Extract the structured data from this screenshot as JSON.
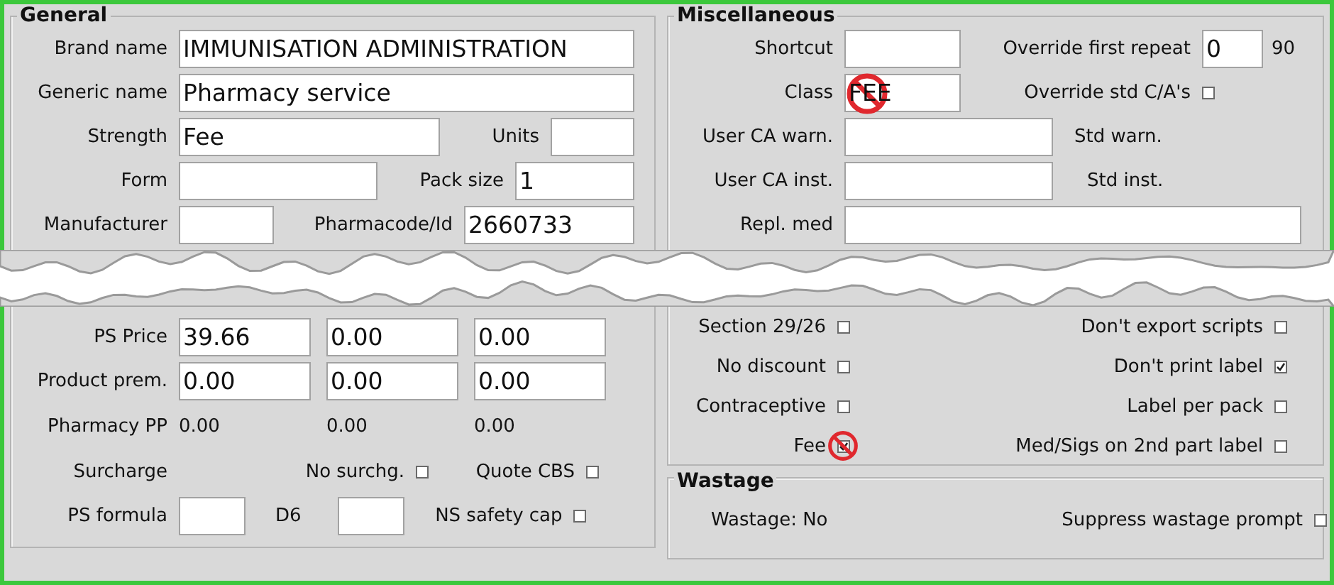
{
  "general": {
    "title": "General",
    "brand_name": {
      "label": "Brand name",
      "value": "IMMUNISATION ADMINISTRATION"
    },
    "generic_name": {
      "label": "Generic name",
      "value": "Pharmacy service"
    },
    "strength": {
      "label": "Strength",
      "value": "Fee"
    },
    "units": {
      "label": "Units"
    },
    "form": {
      "label": "Form"
    },
    "pack_size": {
      "label": "Pack size",
      "value": "1"
    },
    "manufacturer": {
      "label": "Manufacturer"
    },
    "pharmacode": {
      "label": "Pharmacode/Id",
      "value": "2660733"
    }
  },
  "pricing": {
    "ps_price": {
      "label": "PS Price",
      "values": [
        "39.66",
        "0.00",
        "0.00"
      ]
    },
    "product_prem": {
      "label": "Product prem.",
      "values": [
        "0.00",
        "0.00",
        "0.00"
      ]
    },
    "pharmacy_pp": {
      "label": "Pharmacy PP",
      "values": [
        "0.00",
        "0.00",
        "0.00"
      ]
    },
    "surcharge": {
      "label": "Surcharge"
    },
    "no_surcharge": {
      "label": "No surchg.",
      "checked": false
    },
    "quote_cbs": {
      "label": "Quote CBS",
      "checked": false
    },
    "ps_formula": {
      "label": "PS formula"
    },
    "d6": {
      "label": "D6"
    },
    "ns_safety_cap": {
      "label": "NS safety cap",
      "checked": false
    }
  },
  "miscellaneous": {
    "title": "Miscellaneous",
    "shortcut": {
      "label": "Shortcut"
    },
    "override_first_repeat": {
      "label": "Override first repeat",
      "value": "0",
      "suffix": "90"
    },
    "class": {
      "label": "Class",
      "value": "FEE"
    },
    "override_std_ca": {
      "label": "Override std C/A's",
      "checked": false
    },
    "user_ca_warn": {
      "label": "User CA warn."
    },
    "std_warn": {
      "label": "Std warn."
    },
    "user_ca_inst": {
      "label": "User CA inst."
    },
    "std_inst": {
      "label": "Std inst."
    },
    "repl_med": {
      "label": "Repl. med"
    }
  },
  "flags": [
    {
      "left": {
        "label": "Section 29/26",
        "checked": false
      },
      "right": {
        "label": "Don't export scripts",
        "checked": false
      }
    },
    {
      "left": {
        "label": "No discount",
        "checked": false
      },
      "right": {
        "label": "Don't print label",
        "checked": true
      }
    },
    {
      "left": {
        "label": "Contraceptive",
        "checked": false
      },
      "right": {
        "label": "Label per pack",
        "checked": false
      }
    },
    {
      "left": {
        "label": "Fee",
        "checked": true
      },
      "right": {
        "label": "Med/Sigs on 2nd part label",
        "checked": false
      }
    }
  ],
  "wastage": {
    "title": "Wastage",
    "status": "Wastage: No",
    "suppress": {
      "label": "Suppress wastage prompt",
      "checked": false
    }
  }
}
